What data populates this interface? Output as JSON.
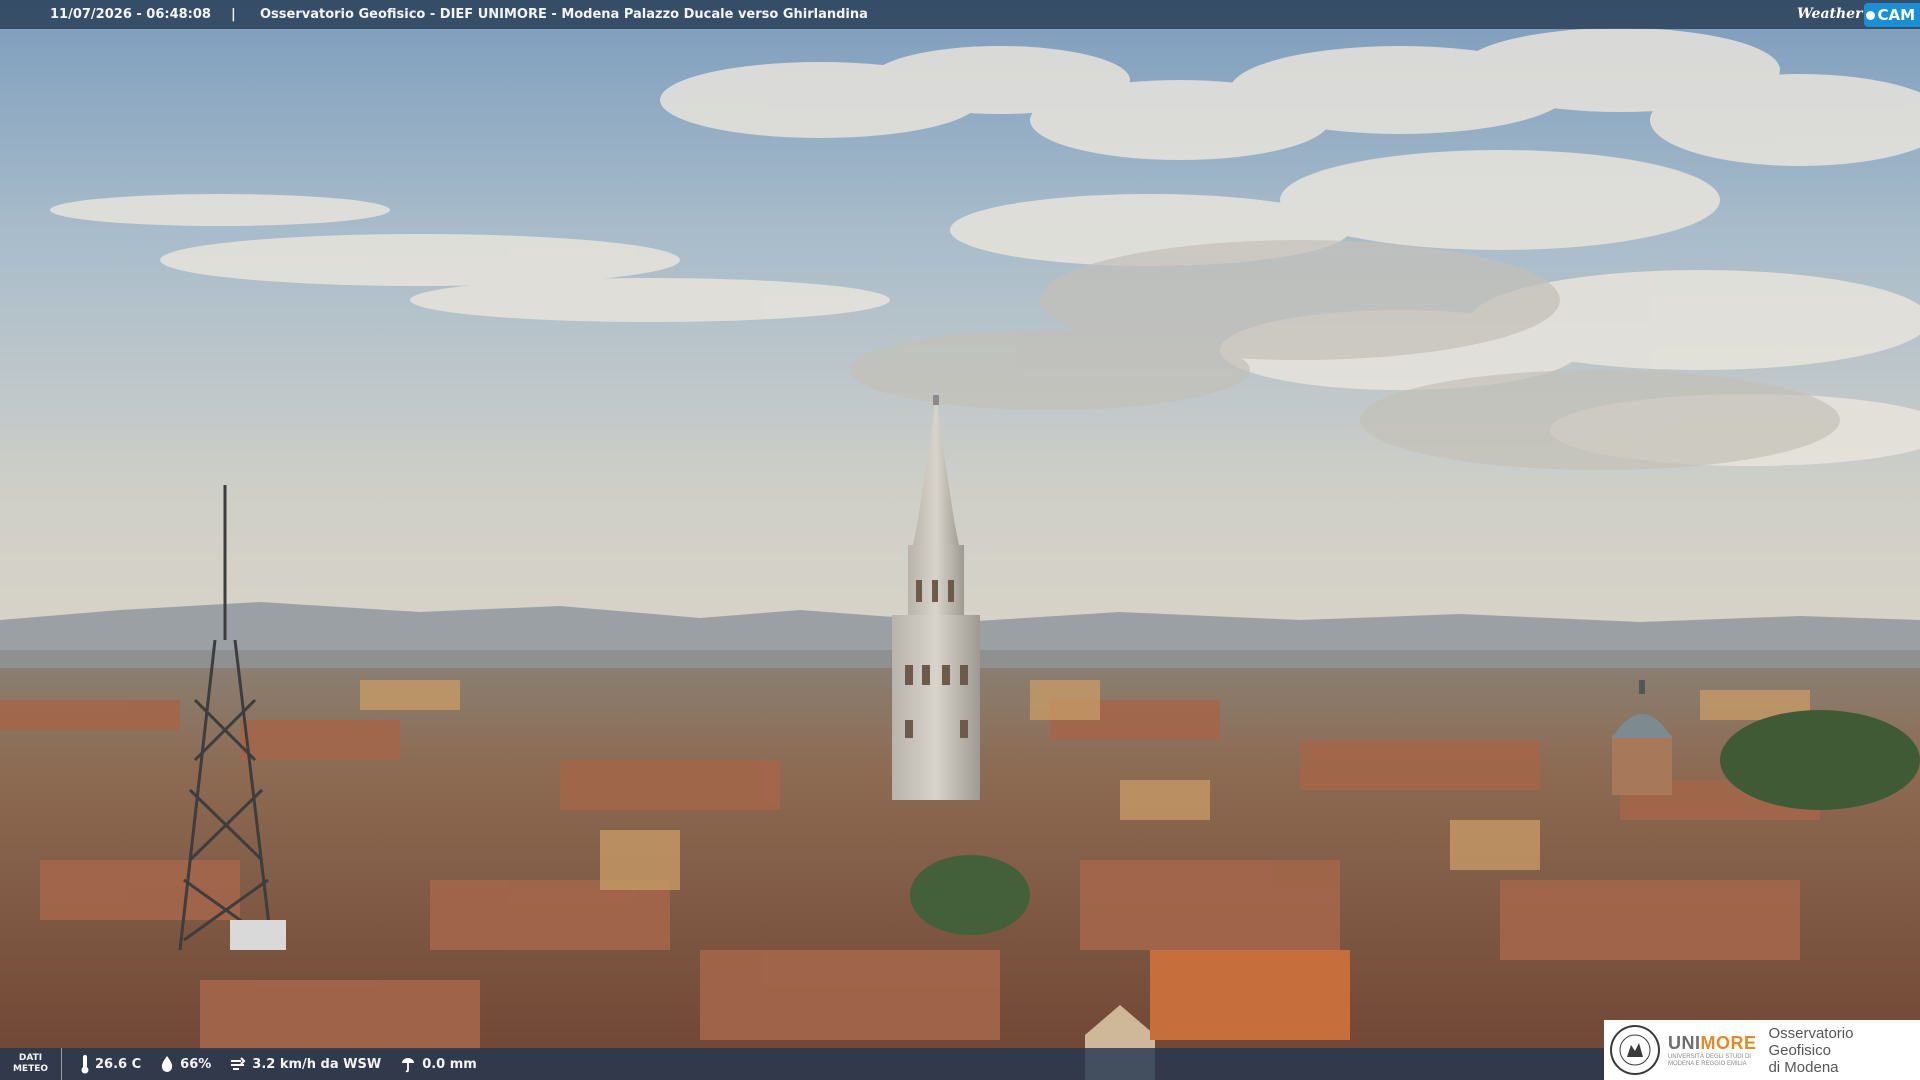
{
  "overlay": {
    "timestamp": "11/07/2026 - 06:48:08",
    "separator": "|",
    "camera_title": "Osservatorio Geofisico - DIEF UNIMORE - Modena Palazzo Ducale verso Ghirlandina",
    "logo": {
      "weather": "Weather",
      "cam": "CAM"
    }
  },
  "weather_bar": {
    "label_line1": "DATI",
    "label_line2": "METEO",
    "temperature": "26.6 C",
    "humidity": "66%",
    "wind": "3.2 km/h da WSW",
    "rain": "0.0 mm",
    "icons": [
      "thermometer-icon",
      "humidity-drop-icon",
      "wind-icon",
      "rain-icon"
    ]
  },
  "sponsor": {
    "university_prefix": "UNI",
    "university_suffix": "MORE",
    "university_subtitle_1": "UNIVERSITÀ DEGLI STUDI DI",
    "university_subtitle_2": "MODENA E REGGIO EMILIA",
    "observatory_line1": "Osservatorio Geofisico",
    "observatory_line2": "di Modena"
  },
  "colors": {
    "sky_top": "#7f9fbf",
    "sky_horizon": "#d6d2c6",
    "roof": "#9a5a3c",
    "accent_orange": "#e38b2b",
    "logo_blue": "#1b8fd6"
  }
}
